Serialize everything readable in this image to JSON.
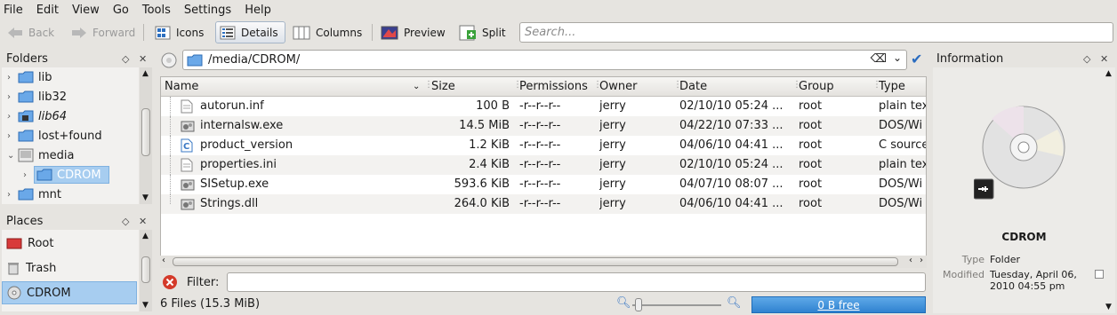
{
  "menu": [
    "File",
    "Edit",
    "View",
    "Go",
    "Tools",
    "Settings",
    "Help"
  ],
  "toolbar": {
    "back": "Back",
    "forward": "Forward",
    "icons": "Icons",
    "details": "Details",
    "columns": "Columns",
    "preview": "Preview",
    "split": "Split",
    "search_placeholder": "Search..."
  },
  "folders": {
    "title": "Folders",
    "items": [
      {
        "label": "lib"
      },
      {
        "label": "lib32"
      },
      {
        "label": "lib64"
      },
      {
        "label": "lost+found"
      },
      {
        "label": "media"
      },
      {
        "label": "CDROM"
      },
      {
        "label": "mnt"
      }
    ]
  },
  "places": {
    "title": "Places",
    "items": [
      {
        "label": "Root"
      },
      {
        "label": "Trash"
      },
      {
        "label": "CDROM"
      }
    ]
  },
  "location": {
    "path": "/media/CDROM/"
  },
  "columns": [
    "Name",
    "Size",
    "Permissions",
    "Owner",
    "Date",
    "Group",
    "Type"
  ],
  "files": [
    {
      "name": "autorun.inf",
      "size": "100 B",
      "perm": "-r--r--r--",
      "owner": "jerry",
      "date": "02/10/10 05:24 ...",
      "group": "root",
      "type": "plain tex"
    },
    {
      "name": "internalsw.exe",
      "size": "14.5 MiB",
      "perm": "-r--r--r--",
      "owner": "jerry",
      "date": "04/22/10 07:33 ...",
      "group": "root",
      "type": "DOS/Wi"
    },
    {
      "name": "product_version",
      "size": "1.2 KiB",
      "perm": "-r--r--r--",
      "owner": "jerry",
      "date": "04/06/10 04:41 ...",
      "group": "root",
      "type": "C source"
    },
    {
      "name": "properties.ini",
      "size": "2.4 KiB",
      "perm": "-r--r--r--",
      "owner": "jerry",
      "date": "02/10/10 05:24 ...",
      "group": "root",
      "type": "plain tex"
    },
    {
      "name": "SISetup.exe",
      "size": "593.6 KiB",
      "perm": "-r--r--r--",
      "owner": "jerry",
      "date": "04/07/10 08:07 ...",
      "group": "root",
      "type": "DOS/Wi"
    },
    {
      "name": "Strings.dll",
      "size": "264.0 KiB",
      "perm": "-r--r--r--",
      "owner": "jerry",
      "date": "04/06/10 04:41 ...",
      "group": "root",
      "type": "DOS/Wi"
    }
  ],
  "filter": {
    "label": "Filter:"
  },
  "status": {
    "summary": "6 Files (15.3 MiB)",
    "free": "0 B free"
  },
  "information": {
    "title": "Information",
    "name": "CDROM",
    "type_label": "Type",
    "type_value": "Folder",
    "modified_label": "Modified",
    "modified_line1": "Tuesday, April 06,",
    "modified_line2": "2010 04:55 pm"
  }
}
